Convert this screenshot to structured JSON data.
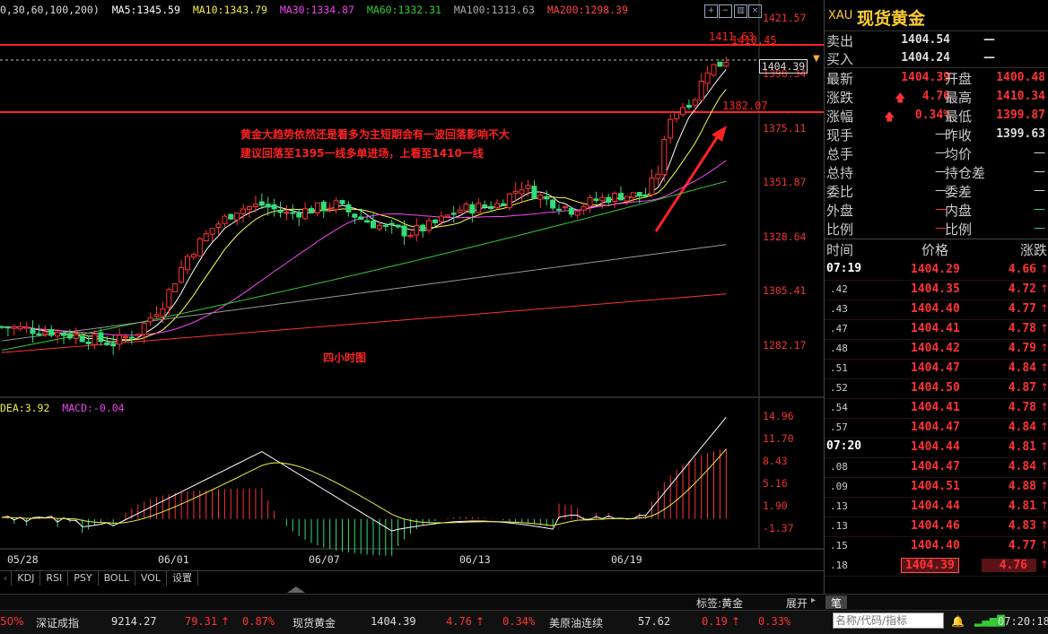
{
  "ma_indicator": {
    "prefix": "0,30,60,100,200)",
    "ma5": "MA5:1345.59",
    "ma10": "MA10:1343.79",
    "ma30": "MA30:1334.87",
    "ma60": "MA60:1332.31",
    "ma100": "MA100:1313.63",
    "ma200": "MA200:1298.39"
  },
  "macd_indicator": {
    "dea": "DEA:3.92",
    "macd": "MACD:-0.04"
  },
  "price_axis": [
    "1421.57",
    "1398.34",
    "1375.11",
    "1351.87",
    "1328.64",
    "1305.41",
    "1282.17"
  ],
  "macd_axis": [
    "14.96",
    "11.70",
    "8.43",
    "5.16",
    "1.90",
    "-1.37"
  ],
  "date_axis": [
    "05/28",
    "06/01",
    "06/07",
    "06/13",
    "06/19"
  ],
  "marks": {
    "high_label": "1411.63",
    "high_label2": "1410.45",
    "support_label": "1382.07",
    "current_price": "1404.39"
  },
  "annotations": {
    "line1": "黄金大趋势依然还是看多为主短期会有一波回落影响不大",
    "line2": "建议回落至1395一线多单进场，上看至1410一线",
    "period": "四小时图"
  },
  "tabs": [
    "KDJ",
    "RSI",
    "PSY",
    "BOLL",
    "VOL",
    "设置"
  ],
  "status": {
    "tag": "标签:黄金",
    "expand": "展开",
    "pen": "笔"
  },
  "ticker": {
    "pct0": "50%",
    "idx_name": "深证成指",
    "idx_value": "9214.27",
    "idx_change": "79.31",
    "idx_pct": "0.87%",
    "gold_name": "现货黄金",
    "gold_value": "1404.39",
    "gold_change": "4.76",
    "gold_pct": "0.34%",
    "oil_name": "美原油连续",
    "oil_value": "57.62",
    "oil_change": "0.19",
    "oil_pct": "0.33%",
    "search_placeholder": "名称/代码/指标",
    "clock": "07:20:18"
  },
  "quote": {
    "code": "XAU",
    "name": "现货黄金",
    "sell_label": "卖出",
    "sell": "1404.54",
    "sell_vol": "—",
    "buy_label": "买入",
    "buy": "1404.24",
    "buy_vol": "—",
    "latest_label": "最新",
    "latest": "1404.39",
    "open_label": "开盘",
    "open": "1400.48",
    "change_label": "涨跌",
    "change": "4.76",
    "high_label": "最高",
    "high": "1410.34",
    "pct_label": "涨幅",
    "pct": "0.34%",
    "low_label": "最低",
    "low": "1399.87",
    "hand_label": "现手",
    "hand": "—",
    "prev_label": "昨收",
    "prev": "1399.63",
    "total_label": "总手",
    "total": "—",
    "avg_label": "均价",
    "avg": "—",
    "hold_label": "总持",
    "hold": "—",
    "holddiff_label": "持仓差",
    "holddiff": "—",
    "bidratio_label": "委比",
    "bidratio": "—",
    "biddiff_label": "委差",
    "biddiff": "—",
    "outer_label": "外盘",
    "outer": "—",
    "inner_label": "内盘",
    "inner": "—",
    "ratio1_label": "比例",
    "ratio1": "—",
    "ratio2_label": "比例",
    "ratio2": "—"
  },
  "trades_header": {
    "time": "时间",
    "price": "价格",
    "change": "涨跌"
  },
  "trades": [
    {
      "t": "07:19",
      "p": "1404.29",
      "c": "4.66"
    },
    {
      "t": ".42",
      "p": "1404.35",
      "c": "4.72"
    },
    {
      "t": ".43",
      "p": "1404.40",
      "c": "4.77"
    },
    {
      "t": ".47",
      "p": "1404.41",
      "c": "4.78"
    },
    {
      "t": ".48",
      "p": "1404.42",
      "c": "4.79"
    },
    {
      "t": ".51",
      "p": "1404.47",
      "c": "4.84"
    },
    {
      "t": ".52",
      "p": "1404.50",
      "c": "4.87"
    },
    {
      "t": ".54",
      "p": "1404.41",
      "c": "4.78"
    },
    {
      "t": ".57",
      "p": "1404.47",
      "c": "4.84"
    },
    {
      "t": "07:20",
      "p": "1404.44",
      "c": "4.81"
    },
    {
      "t": ".08",
      "p": "1404.47",
      "c": "4.84"
    },
    {
      "t": ".09",
      "p": "1404.51",
      "c": "4.88"
    },
    {
      "t": ".13",
      "p": "1404.44",
      "c": "4.81"
    },
    {
      "t": ".13",
      "p": "1404.46",
      "c": "4.83"
    },
    {
      "t": ".15",
      "p": "1404.40",
      "c": "4.77"
    },
    {
      "t": ".18",
      "p": "1404.39",
      "c": "4.76"
    }
  ],
  "colors": {
    "up": "#ff3333",
    "down": "#33dd77",
    "ma5": "#ffffff",
    "ma10": "#ffff44",
    "ma30": "#ff44ff",
    "ma60": "#33cc33",
    "ma100": "#999999",
    "ma200": "#ff3333"
  }
}
